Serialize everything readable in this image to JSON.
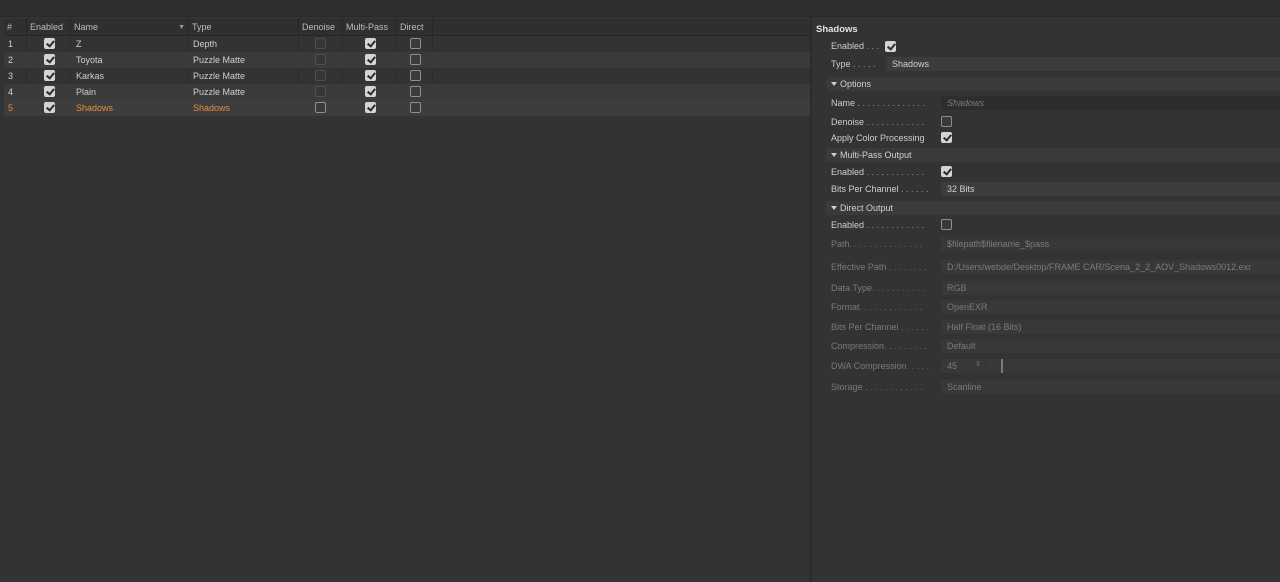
{
  "table": {
    "columns": [
      "#",
      "Enabled",
      "Name",
      "Type",
      "Denoise",
      "Multi-Pass",
      "Direct"
    ],
    "sort_icon": "triangle-down-icon",
    "rows": [
      {
        "num": "1",
        "name": "Z",
        "type": "Depth",
        "enabled": true,
        "denoise": "disabled",
        "multipass": true,
        "direct": false
      },
      {
        "num": "2",
        "name": "Toyota",
        "type": "Puzzle Matte",
        "enabled": true,
        "denoise": "disabled",
        "multipass": true,
        "direct": false
      },
      {
        "num": "3",
        "name": "Karkas",
        "type": "Puzzle Matte",
        "enabled": true,
        "denoise": "disabled",
        "multipass": true,
        "direct": false
      },
      {
        "num": "4",
        "name": "Plain",
        "type": "Puzzle Matte",
        "enabled": true,
        "denoise": "disabled",
        "multipass": true,
        "direct": false
      },
      {
        "num": "5",
        "name": "Shadows",
        "type": "Shadows",
        "enabled": true,
        "denoise": false,
        "multipass": true,
        "direct": false,
        "selected": true
      }
    ]
  },
  "panel": {
    "title": "Shadows",
    "enabled": {
      "label": "Enabled",
      "dots": " . . .",
      "checked": true
    },
    "type": {
      "label": "Type",
      "dots": " . . . . .",
      "value": "Shadows"
    },
    "options": {
      "header": "Options",
      "name": {
        "label": "Name",
        "dots": " . . . . . . . . . . . . . .",
        "value": "Shadows"
      },
      "denoise": {
        "label": "Denoise",
        "dots": " . . . . . . . . . . . .",
        "checked": false
      },
      "apply_color": {
        "label": "Apply Color Processing",
        "checked": true
      }
    },
    "multipass": {
      "header": "Multi-Pass Output",
      "enabled": {
        "label": "Enabled",
        "dots": " . . . . . . . . . . . .",
        "checked": true
      },
      "bits": {
        "label": "Bits Per Channel",
        "dots": " . . . . . .",
        "value": "32 Bits"
      }
    },
    "direct": {
      "header": "Direct Output",
      "enabled": {
        "label": "Enabled",
        "dots": " . . . . . . . . . . . .",
        "checked": false
      },
      "path": {
        "label": "Path",
        "dots": ". . . . . . . . . . . . . . .",
        "value": "$filepath$filename_$pass"
      },
      "effective_path": {
        "label": "Effective Path",
        "dots": " . . . . . . . .",
        "value": "D:/Users/webde/Desktop/FRAME CAR/Scena_2_2_AOV_Shadows0012.exr"
      },
      "data_type": {
        "label": "Data Type",
        "dots": ". . . . . . . . . . .",
        "value": "RGB"
      },
      "format": {
        "label": "Format",
        "dots": ". . . . . . . . . . . . .",
        "value": "OpenEXR"
      },
      "bits": {
        "label": "Bits Per Channel",
        "dots": " . . . . . .",
        "value": "Half Float (16 Bits)"
      },
      "compression": {
        "label": "Compression",
        "dots": ". . . . . . . . .",
        "value": "Default"
      },
      "dwa": {
        "label": "DWA Compression",
        "dots": ". . . . .",
        "value": "45",
        "level": 0.25
      },
      "storage": {
        "label": "Storage",
        "dots": " . . . . . . . . . . . .",
        "value": "Scanline"
      }
    }
  }
}
